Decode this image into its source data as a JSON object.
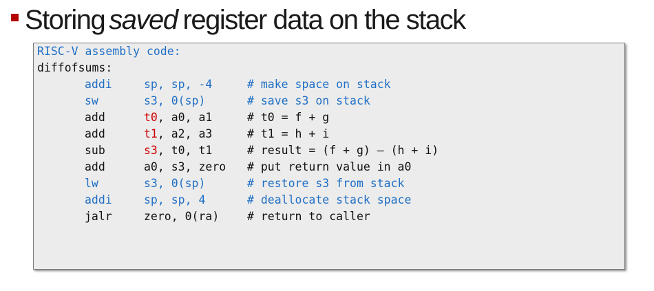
{
  "title": {
    "before": "Storing",
    "emphasis": "saved",
    "after": "register data on the stack"
  },
  "code": {
    "header": "RISC-V assembly code:",
    "label": "diffofsums:",
    "lines": [
      {
        "op": "addi",
        "args": "sp, sp, -4",
        "comment": "# make space on stack",
        "color": "#1f6fc5"
      },
      {
        "op": "sw",
        "args": "s3, 0(sp)",
        "comment": "# save s3 on stack",
        "color": "#1f6fc5"
      },
      {
        "op": "add",
        "dest": "t0",
        "rest": ", a0, a1",
        "comment": "# t0 = f + g",
        "color": "#111111",
        "dest_color": "#cc0000"
      },
      {
        "op": "add",
        "dest": "t1",
        "rest": ", a2, a3",
        "comment": "# t1 = h + i",
        "color": "#111111",
        "dest_color": "#cc0000"
      },
      {
        "op": "sub",
        "dest": "s3",
        "rest": ", t0, t1",
        "comment": "# result = (f + g) – (h + i)",
        "color": "#111111",
        "dest_color": "#cc0000"
      },
      {
        "op": "add",
        "args": "a0, s3, zero",
        "comment": "# put return value in a0",
        "color": "#111111"
      },
      {
        "op": "lw",
        "args": "s3, 0(sp)",
        "comment": "# restore s3 from stack",
        "color": "#1f6fc5"
      },
      {
        "op": "addi",
        "args": "sp, sp, 4",
        "comment": "# deallocate stack space",
        "color": "#1f6fc5"
      },
      {
        "op": "jalr",
        "args": "zero, 0(ra)",
        "comment": "# return to caller",
        "color": "#111111"
      }
    ]
  },
  "colors": {
    "accent_bullet": "#b30000",
    "code_blue": "#1f6fc5",
    "code_red": "#cc0000",
    "code_background": "#ececec"
  }
}
